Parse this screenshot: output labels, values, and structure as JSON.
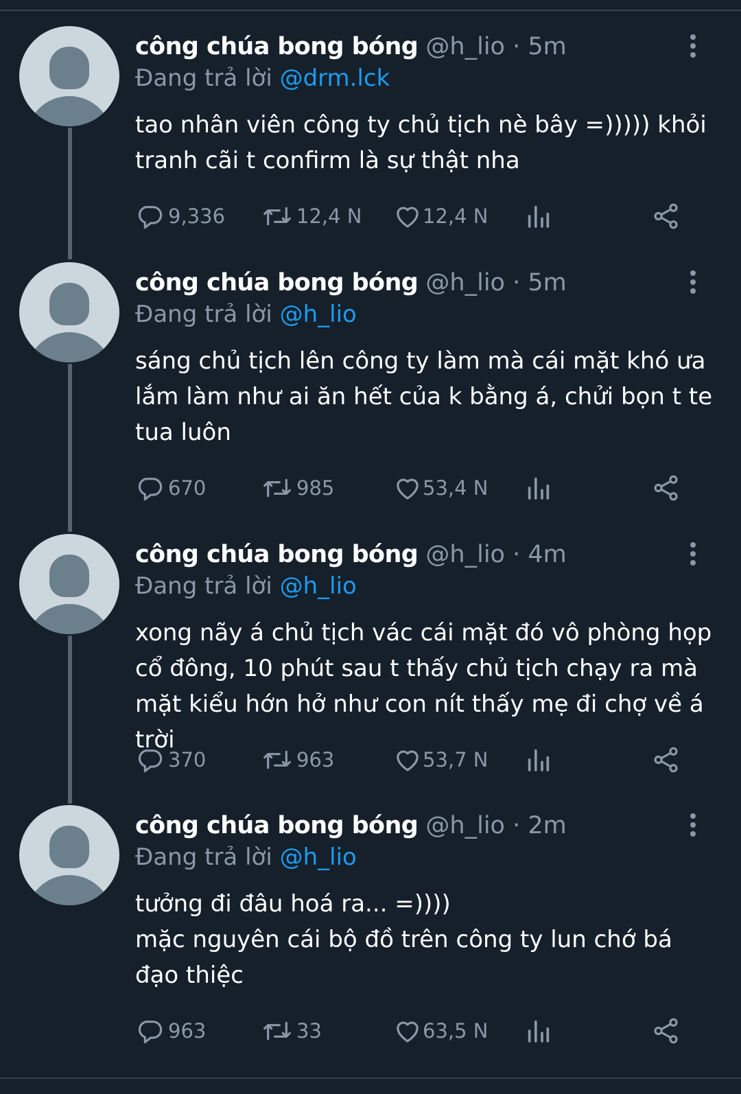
{
  "tweets": [
    {
      "name": "công chúa bong bóng",
      "handle": "@h_lio",
      "time": "5m",
      "reply_prefix": "Đang trả lời",
      "reply_to": "@drm.lck",
      "text": [
        "tao nhân viên công ty chủ tịch nè bây =))))) khỏi tranh cãi t confirm là sự thật nha"
      ],
      "replies": "9,336",
      "retweets": "12,4 N",
      "likes": "12,4 N"
    },
    {
      "name": "công chúa bong bóng",
      "handle": "@h_lio",
      "time": "5m",
      "reply_prefix": "Đang trả lời",
      "reply_to": "@h_lio",
      "text": [
        "sáng chủ tịch lên công ty làm mà cái mặt khó ưa lắm làm như ai ăn hết của k bằng á, chửi bọn t te tua luôn"
      ],
      "replies": "670",
      "retweets": "985",
      "likes": "53,4 N"
    },
    {
      "name": "công chúa bong bóng",
      "handle": "@h_lio",
      "time": "4m",
      "reply_prefix": "Đang trả lời",
      "reply_to": "@h_lio",
      "text": [
        "xong nãy á chủ tịch vác cái mặt đó vô phòng họp cổ đông, 10 phút sau t thấy chủ tịch chạy ra mà mặt kiểu hớn hở như con nít thấy mẹ đi chợ về á trời"
      ],
      "replies": "370",
      "retweets": "963",
      "likes": "53,7 N"
    },
    {
      "name": "công chúa bong bóng",
      "handle": "@h_lio",
      "time": "2m",
      "reply_prefix": "Đang trả lời",
      "reply_to": "@h_lio",
      "text": [
        "tưởng đi đâu hoá ra... =))))",
        "mặc nguyên cái bộ đồ trên công ty lun chớ bá đạo thiệc"
      ],
      "replies": "963",
      "retweets": "33",
      "likes": "63,5 N"
    }
  ],
  "icons": {
    "reply": "reply-icon",
    "retweet": "retweet-icon",
    "like": "heart-icon",
    "views": "analytics-icon",
    "share": "share-icon",
    "more": "more-vertical-icon"
  },
  "colors": {
    "background": "#15202b",
    "accent": "#1d9bf0",
    "muted": "#8b98a5",
    "divider": "#38444d",
    "avatar_bg": "#ccd6dd",
    "avatar_fg": "#6b7f8d"
  }
}
